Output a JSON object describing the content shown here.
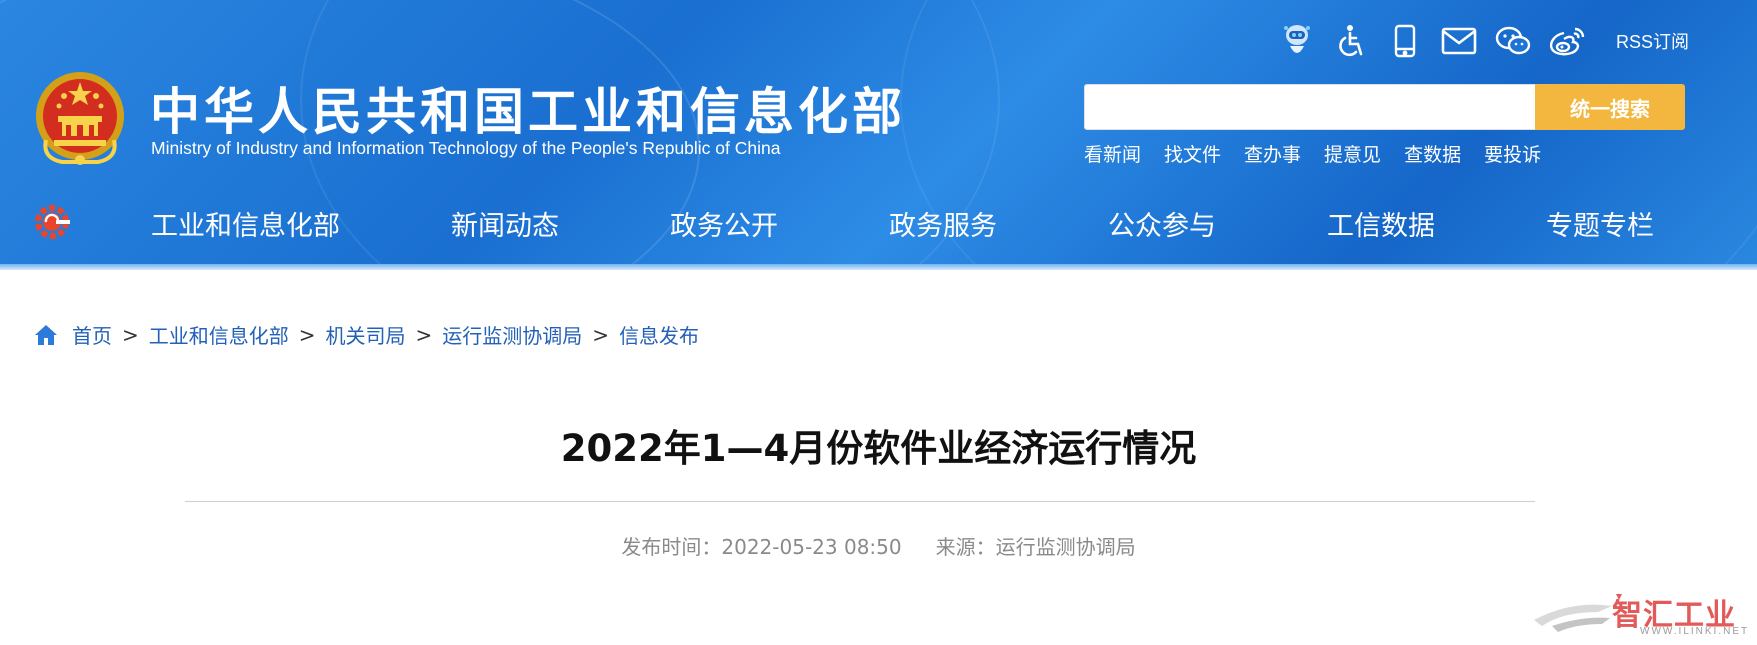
{
  "header": {
    "title_cn": "中华人民共和国工业和信息化部",
    "title_en": "Ministry of Industry and Information Technology of the People's Republic of China",
    "tool_icons": [
      "robot-assistant-icon",
      "accessibility-icon",
      "mobile-icon",
      "mail-icon",
      "wechat-icon",
      "weibo-icon"
    ],
    "rss_label": "RSS订阅",
    "search": {
      "value": "",
      "placeholder": "",
      "button_label": "统一搜索"
    },
    "quick_links": [
      "看新闻",
      "找文件",
      "查办事",
      "提意见",
      "查数据",
      "要投诉"
    ]
  },
  "nav": {
    "items": [
      "工业和信息化部",
      "新闻动态",
      "政务公开",
      "政务服务",
      "公众参与",
      "工信数据",
      "专题专栏"
    ]
  },
  "breadcrumb": {
    "items": [
      "首页",
      "工业和信息化部",
      "机关司局",
      "运行监测协调局",
      "信息发布"
    ],
    "separator": ">"
  },
  "article": {
    "title": "2022年1—4月份软件业经济运行情况",
    "publish_label": "发布时间：",
    "publish_time": "2022-05-23 08:50",
    "source_label": "来源：",
    "source": "运行监测协调局"
  },
  "watermark": {
    "text": "智汇工业",
    "sub": "WWW.ILINKI.NET"
  },
  "colors": {
    "header_blue": "#1a6fd0",
    "search_button": "#f3b73f",
    "breadcrumb_link": "#2361b8",
    "watermark_red": "#e35a5a"
  }
}
